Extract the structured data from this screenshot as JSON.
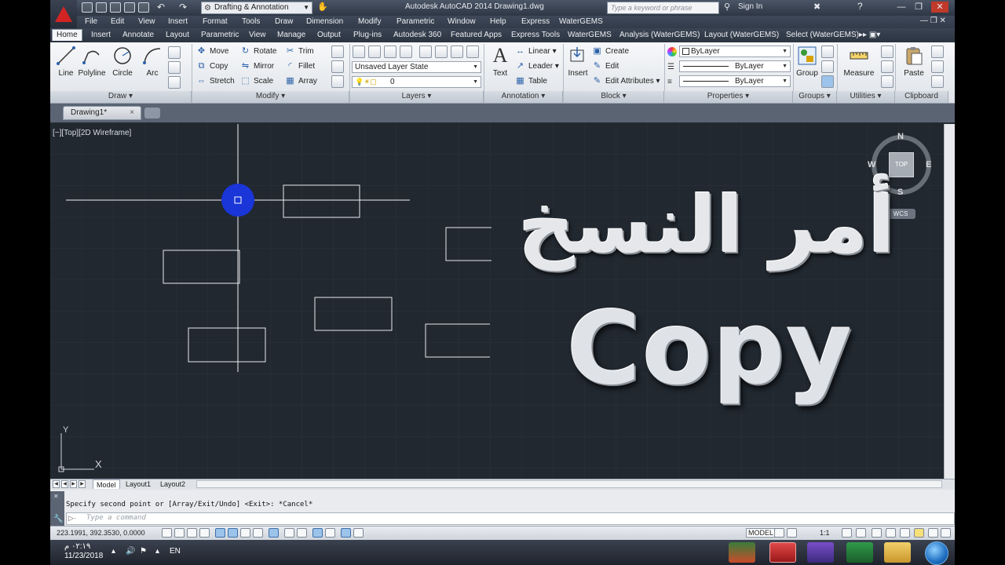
{
  "window": {
    "app_title": "Autodesk AutoCAD 2014    Drawing1.dwg",
    "workspace": "Drafting & Annotation",
    "search_placeholder": "Type a keyword or phrase",
    "sign_in": "Sign In"
  },
  "menubar": {
    "items": [
      "File",
      "Edit",
      "View",
      "Insert",
      "Format",
      "Tools",
      "Draw",
      "Dimension",
      "Modify",
      "Parametric",
      "Window",
      "Help",
      "Express",
      "WaterGEMS"
    ]
  },
  "ribbon_tabs": {
    "items": [
      "Home",
      "Insert",
      "Annotate",
      "Layout",
      "Parametric",
      "View",
      "Manage",
      "Output",
      "Plug-ins",
      "Autodesk 360",
      "Featured Apps",
      "Express Tools",
      "WaterGEMS",
      "Analysis (WaterGEMS)",
      "Layout (WaterGEMS)",
      "Select (WaterGEMS)"
    ],
    "active": "Home"
  },
  "ribbon": {
    "draw": {
      "line": "Line",
      "polyline": "Polyline",
      "circle": "Circle",
      "arc": "Arc",
      "title": "Draw"
    },
    "modify": {
      "move": "Move",
      "rotate": "Rotate",
      "trim": "Trim",
      "copy": "Copy",
      "mirror": "Mirror",
      "fillet": "Fillet",
      "stretch": "Stretch",
      "scale": "Scale",
      "array": "Array",
      "title": "Modify"
    },
    "layers": {
      "state": "Unsaved Layer State",
      "current": "0",
      "title": "Layers"
    },
    "annotation": {
      "text": "Text",
      "linear": "Linear",
      "leader": "Leader",
      "table": "Table",
      "title": "Annotation"
    },
    "block": {
      "insert": "Insert",
      "create": "Create",
      "edit": "Edit",
      "edit_attributes": "Edit Attributes",
      "title": "Block"
    },
    "properties": {
      "color": "ByLayer",
      "linetype": "ByLayer",
      "lineweight": "ByLayer",
      "title": "Properties"
    },
    "groups": {
      "group": "Group",
      "title": "Groups"
    },
    "utilities": {
      "measure": "Measure",
      "title": "Utilities"
    },
    "clipboard": {
      "paste": "Paste",
      "title": "Clipboard"
    }
  },
  "document": {
    "tab": "Drawing1*"
  },
  "viewport": {
    "label": "[−][Top][2D Wireframe]",
    "viewcube": {
      "top": "TOP",
      "n": "N",
      "s": "S",
      "e": "E",
      "w": "W",
      "wcs": "WCS"
    },
    "ucs_x": "X",
    "ucs_y": "Y"
  },
  "overlay": {
    "arabic": "أمر النسخ",
    "english": "Copy"
  },
  "layout_tabs": [
    "Model",
    "Layout1",
    "Layout2"
  ],
  "command_line": {
    "history": "Specify second point or [Array/Exit/Undo] <Exit>: *Cancel*",
    "placeholder": "Type a command"
  },
  "status": {
    "coords": "223.1991, 392.3530, 0.0000",
    "model": "MODEL",
    "scale": "1:1"
  },
  "taskbar": {
    "time": "٠٢:١٩ م",
    "date": "11/23/2018",
    "lang": "EN"
  },
  "colors": {
    "canvas": "#212830",
    "crosshair": "#ffffff",
    "pickbox": "#1a35d8",
    "accent_red": "#d32424"
  }
}
